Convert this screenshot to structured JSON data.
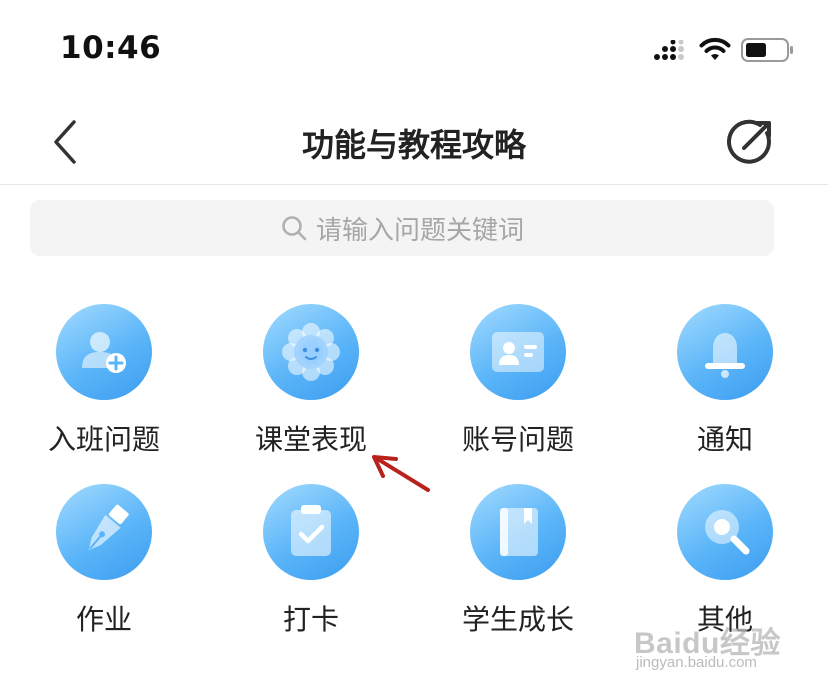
{
  "status_bar": {
    "time": "10:46"
  },
  "nav": {
    "title": "功能与教程攻略",
    "back_icon": "chevron-left-icon",
    "share_icon": "share-arrow-icon"
  },
  "search": {
    "placeholder": "请输入问题关键词"
  },
  "grid": {
    "items": [
      {
        "label": "入班问题",
        "icon": "user-add-icon"
      },
      {
        "label": "课堂表现",
        "icon": "flower-smile-icon"
      },
      {
        "label": "账号问题",
        "icon": "id-card-icon"
      },
      {
        "label": "通知",
        "icon": "bell-icon"
      },
      {
        "label": "作业",
        "icon": "pen-nib-icon"
      },
      {
        "label": "打卡",
        "icon": "clipboard-check-icon"
      },
      {
        "label": "学生成长",
        "icon": "book-icon"
      },
      {
        "label": "其他",
        "icon": "magnifier-icon"
      }
    ]
  },
  "annotation": {
    "arrow_color": "#b8211c"
  },
  "colors": {
    "icon_gradient_start": "#a3dbff",
    "icon_gradient_end": "#3b9cf0"
  },
  "watermark": {
    "main": "Baidu经验",
    "sub": "jingyan.baidu.com"
  }
}
